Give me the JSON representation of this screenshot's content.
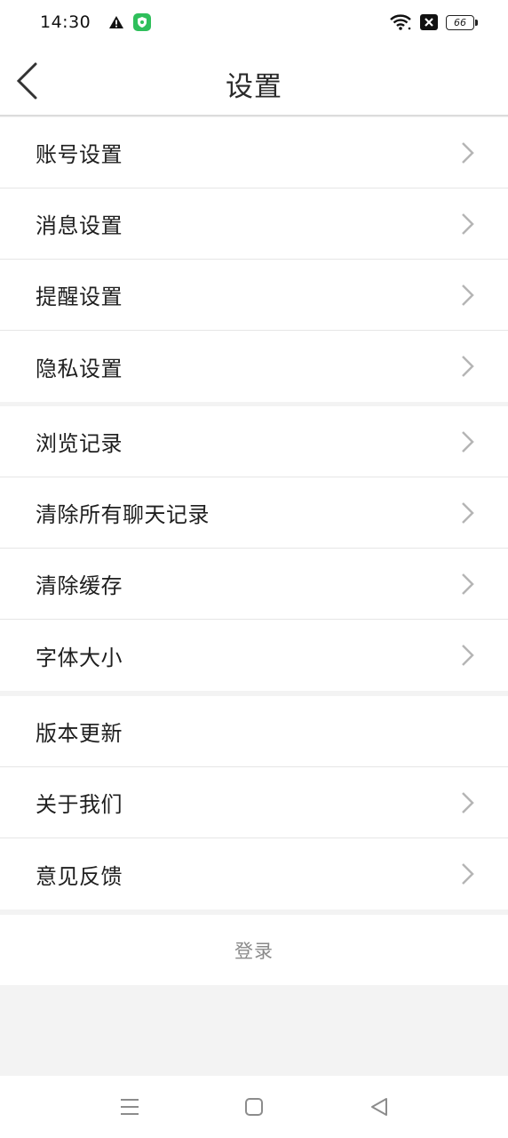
{
  "status_bar": {
    "time": "14:30",
    "left_icons": [
      "warning-icon",
      "shield-app-icon"
    ],
    "right_icons": [
      "wifi-icon",
      "sim-off-icon",
      "battery-icon"
    ],
    "battery_level": "66"
  },
  "header": {
    "title": "设置",
    "back_icon": "chevron-left-icon"
  },
  "sections": [
    {
      "items": [
        {
          "label": "账号设置",
          "chevron": true
        },
        {
          "label": "消息设置",
          "chevron": true
        },
        {
          "label": "提醒设置",
          "chevron": true
        },
        {
          "label": "隐私设置",
          "chevron": true
        }
      ]
    },
    {
      "items": [
        {
          "label": "浏览记录",
          "chevron": true
        },
        {
          "label": "清除所有聊天记录",
          "chevron": true
        },
        {
          "label": "清除缓存",
          "chevron": true
        },
        {
          "label": "字体大小",
          "chevron": true
        }
      ]
    },
    {
      "items": [
        {
          "label": "版本更新",
          "chevron": false
        },
        {
          "label": "关于我们",
          "chevron": true
        },
        {
          "label": "意见反馈",
          "chevron": true
        }
      ]
    }
  ],
  "login": {
    "label": "登录"
  },
  "nav_bar": {
    "buttons": [
      "menu-icon",
      "home-icon",
      "back-triangle-icon"
    ]
  },
  "colors": {
    "background": "#f3f3f3",
    "surface": "#ffffff",
    "text": "#1f1f1f",
    "chevron": "#b5b5b5",
    "login_text": "#8a8a8a",
    "shield_green": "#2fbf5b"
  }
}
